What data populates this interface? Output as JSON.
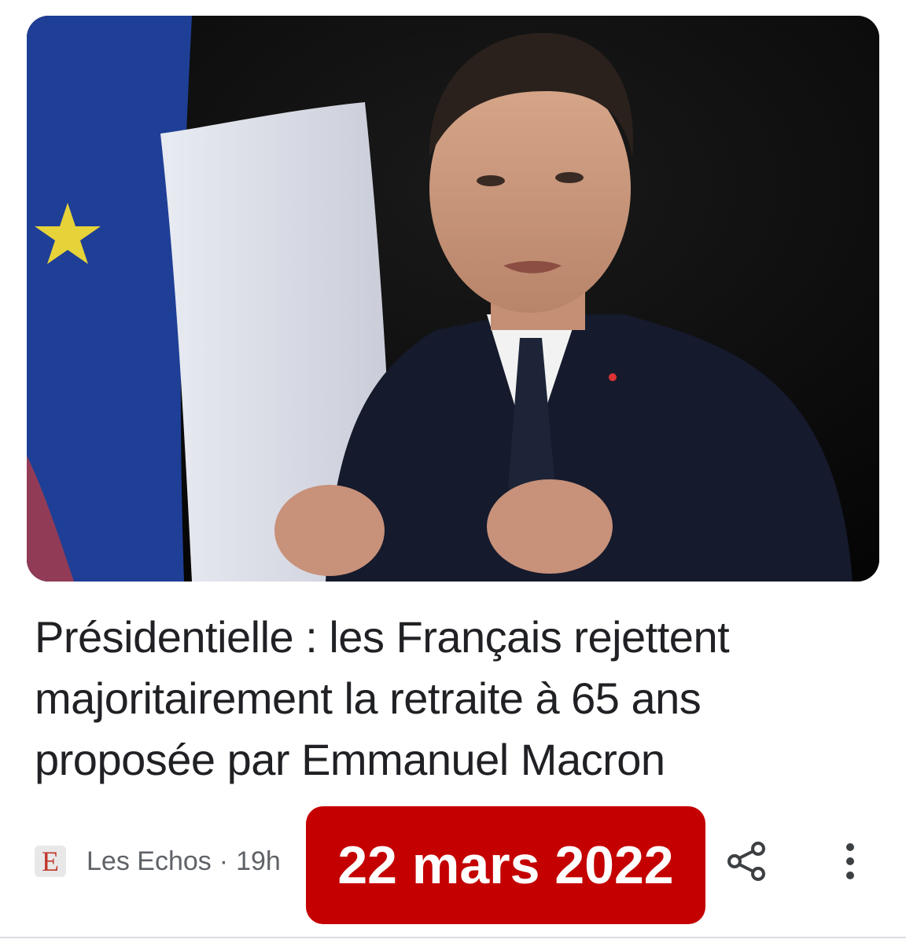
{
  "article": {
    "headline": "Présidentielle : les Français rejettent majoritairement la retraite à 65 ans proposée par Emmanuel Macron",
    "source": {
      "name": "Les Echos",
      "logo_letter": "E",
      "separator": "·",
      "age": "19h"
    },
    "date_badge": "22 mars 2022",
    "actions": {
      "share_icon": "share-icon",
      "more_icon": "more-vert-icon"
    }
  },
  "colors": {
    "headline": "#202124",
    "meta_text": "#5f6368",
    "badge_bg": "#c40000",
    "badge_text": "#ffffff",
    "logo_accent": "#c0392b"
  }
}
